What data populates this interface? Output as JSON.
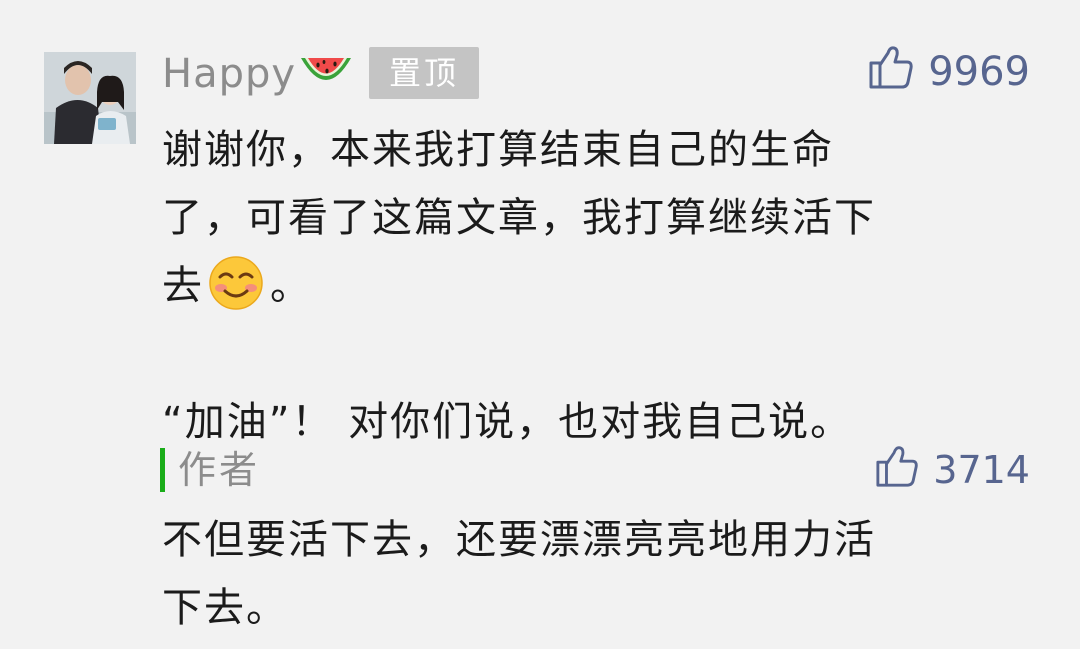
{
  "comment": {
    "username": "Happy",
    "pinned_badge": "置顶",
    "likes": "9969",
    "lines": [
      "谢谢你，本来我打算结束自己的生命",
      "了，可看了这篇文章，我打算继续活下",
      "去",
      "。",
      "“加油”！ 对你们说，也对我自己说。"
    ]
  },
  "author_reply": {
    "label": "作者",
    "likes": "3714",
    "lines": [
      "不但要活下去，还要漂漂亮亮地用力活",
      "下去。"
    ]
  },
  "icons": {
    "avatar": "user-avatar-photo",
    "username_emoji": "watermelon-icon",
    "inline_emoji": "smiling-face-icon",
    "like": "thumbs-up-icon"
  },
  "colors": {
    "background": "#f2f2f2",
    "username": "#8c8c8c",
    "like_count": "#57658f",
    "pinned_badge": "#c4c4c4",
    "author_marker": "#1aad19",
    "body_text": "#1b1b1b"
  }
}
